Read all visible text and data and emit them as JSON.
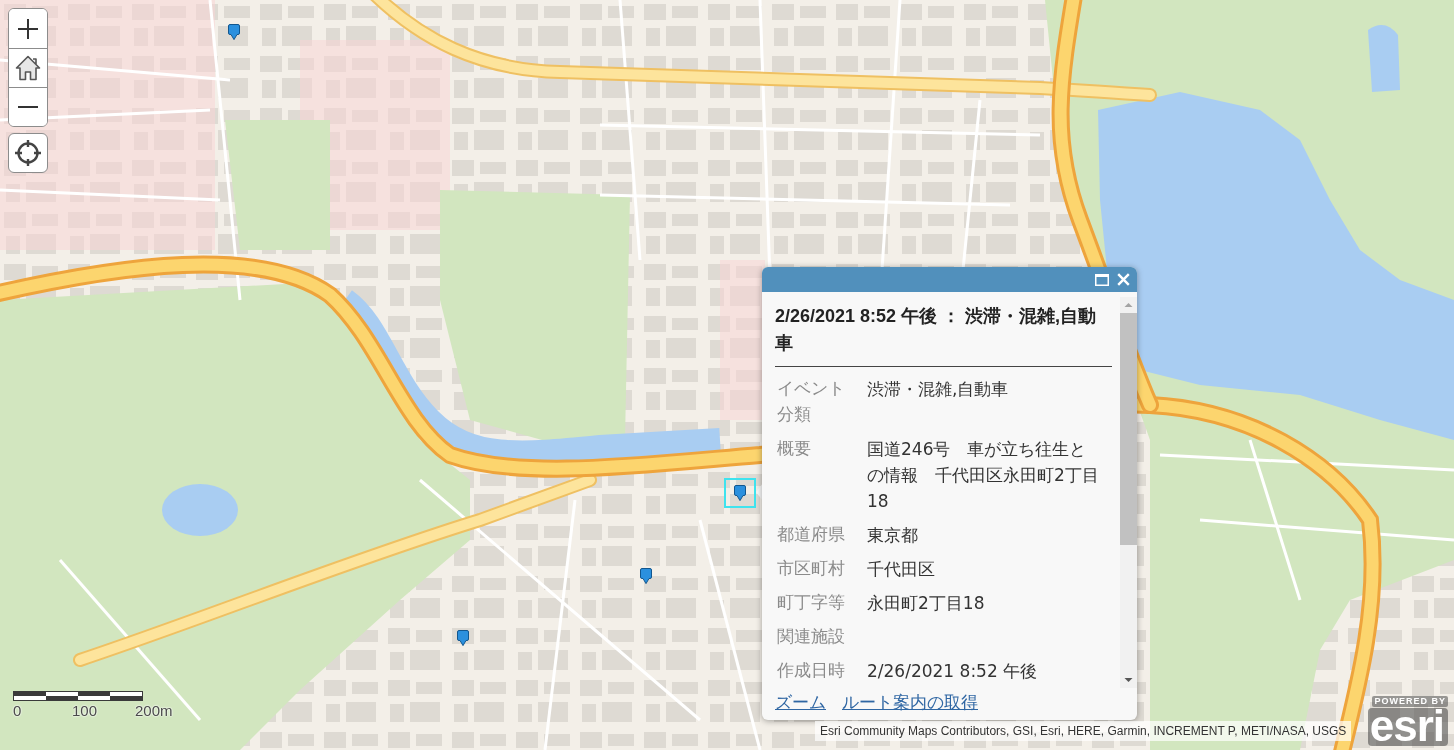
{
  "map": {
    "markers": [
      {
        "selected": false
      },
      {
        "selected": true
      },
      {
        "selected": false
      },
      {
        "selected": false
      }
    ]
  },
  "popup": {
    "title": "2/26/2021 8:52 午後 ： 渋滞・混雑,自動車",
    "fields": [
      {
        "label": "イベント分類",
        "value": "渋滞・混雑,自動車"
      },
      {
        "label": "概要",
        "value": "国道246号　車が立ち往生との情報　千代田区永田町2丁目18"
      },
      {
        "label": "都道府県",
        "value": "東京都"
      },
      {
        "label": "市区町村",
        "value": "千代田区"
      },
      {
        "label": "町丁字等",
        "value": "永田町2丁目18"
      },
      {
        "label": "関連施設"
      },
      {
        "label": "作成日時",
        "value": "2/26/2021 8:52 午後"
      }
    ],
    "actions": [
      "ズーム",
      "ルート案内の取得"
    ]
  },
  "scale_bar": {
    "labels": [
      "0",
      "100",
      "200m"
    ]
  },
  "attribution": "Esri Community Maps Contributors, GSI, Esri, HERE, Garmin, INCREMENT P, METI/NASA, USGS",
  "esri_logo": {
    "tagline": "POWERED BY",
    "wordmark": "esri"
  }
}
